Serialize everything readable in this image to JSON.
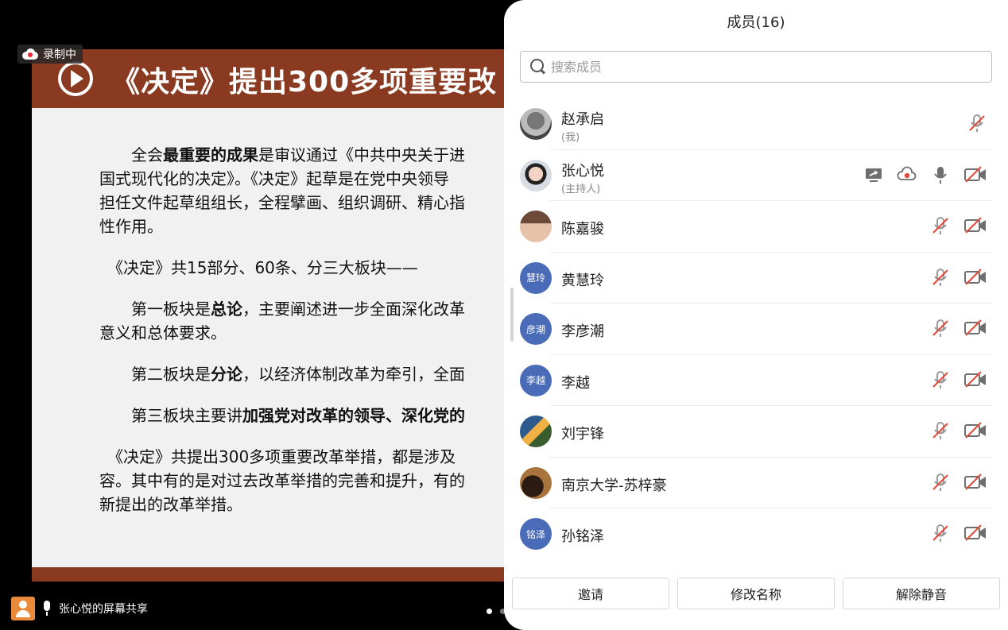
{
  "recording": {
    "label": "录制中"
  },
  "slide": {
    "title": "《决定》提出300多项重要改",
    "paragraphs": [
      [
        "　　全会",
        "最重要的成果",
        "是审议通过《中共中央关于进"
      ],
      [
        "国式现代化的决定》。《决定》起草是在党中央领导"
      ],
      [
        "担任文件起草组组长，全程擘画、组织调研、精心指"
      ],
      [
        "性作用。"
      ],
      [
        "　《决定》共15部分、60条、分三大板块——"
      ],
      [
        "　　第一板块是",
        "总论",
        "，主要阐述进一步全面深化改革"
      ],
      [
        "意义和总体要求。"
      ],
      [
        "　　第二板块是",
        "分论",
        "，以经济体制改革为牵引，全面"
      ],
      [
        "　　第三板块主要讲",
        "加强党对改革的领导、深化党的"
      ],
      [
        "　《决定》共提出300多项重要改革举措，都是涉及"
      ],
      [
        "容。其中有的是对过去改革举措的完善和提升，有的"
      ],
      [
        "新提出的改革举措。"
      ]
    ]
  },
  "share": {
    "text": "张心悦的屏幕共享"
  },
  "panel": {
    "title": "成员(16)",
    "search_placeholder": "搜索成员",
    "members": [
      {
        "name": "赵承启",
        "role": "(我)",
        "avatar": "photo-1",
        "icons": [
          "mic-muted-icon"
        ]
      },
      {
        "name": "张心悦",
        "role": "(主持人)",
        "avatar": "photo-2",
        "icons": [
          "screen-share-icon",
          "cloud-record-icon",
          "mic-icon",
          "camera-off-icon"
        ]
      },
      {
        "name": "陈嘉骏",
        "role": "",
        "avatar": "photo-3",
        "icons": [
          "mic-muted-icon",
          "camera-off-icon"
        ]
      },
      {
        "name": "黄慧玲",
        "role": "",
        "avatar": "initials",
        "initials": "慧玲",
        "icons": [
          "mic-muted-icon",
          "camera-off-icon"
        ]
      },
      {
        "name": "李彦潮",
        "role": "",
        "avatar": "initials",
        "initials": "彦潮",
        "icons": [
          "mic-muted-icon",
          "camera-off-icon"
        ]
      },
      {
        "name": "李越",
        "role": "",
        "avatar": "initials",
        "initials": "李越",
        "icons": [
          "mic-muted-icon",
          "camera-off-icon"
        ]
      },
      {
        "name": "刘宇锋",
        "role": "",
        "avatar": "photo-4",
        "icons": [
          "mic-muted-icon",
          "camera-off-icon"
        ]
      },
      {
        "name": "南京大学-苏梓豪",
        "role": "",
        "avatar": "photo-5",
        "icons": [
          "mic-muted-icon",
          "camera-off-icon"
        ]
      },
      {
        "name": "孙铭泽",
        "role": "",
        "avatar": "initials",
        "initials": "铭泽",
        "icons": [
          "mic-muted-icon",
          "camera-off-icon"
        ]
      }
    ],
    "buttons": {
      "invite": "邀请",
      "rename": "修改名称",
      "unmute": "解除静音"
    }
  },
  "colors": {
    "slide_header": "#8b3a22",
    "avatar_initials_bg": "#4a6cb8",
    "record_red": "#e23a3a"
  }
}
